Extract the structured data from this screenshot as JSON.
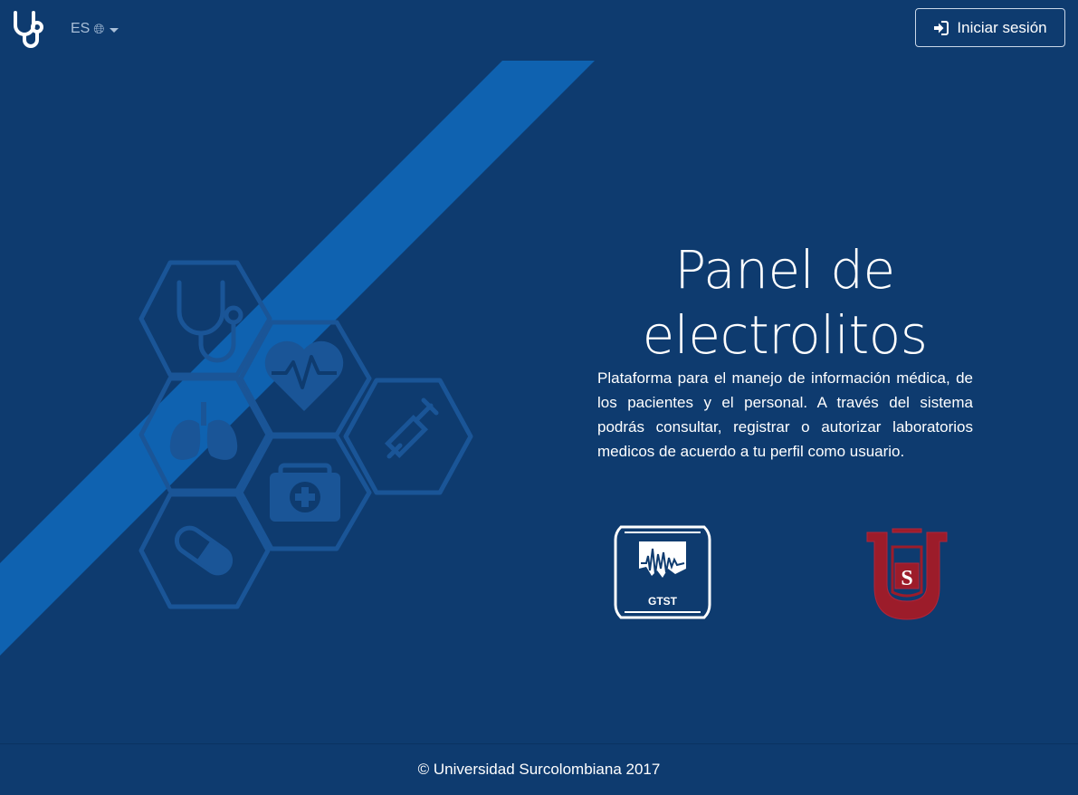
{
  "navbar": {
    "brand_icon": "stethoscope-icon",
    "language": {
      "code": "ES",
      "icon": "translate-icon"
    },
    "login_button": {
      "label": "Iniciar sesión",
      "icon": "sign-in-icon"
    }
  },
  "hero": {
    "title": "Panel de electrolitos",
    "description": "Plataforma para el manejo de información médica, de los pacientes y el personal. A través del sistema podrás consultar, registrar o autorizar laboratorios medicos de acuerdo a tu perfil como usuario.",
    "illustration_icons": [
      "stethoscope-icon",
      "heart-rate-icon",
      "lungs-icon",
      "syringe-icon",
      "medical-kit-icon",
      "pill-icon"
    ]
  },
  "logos": {
    "gtst_label": "GTST",
    "usco_letters": "US"
  },
  "footer": {
    "copyright": "© Universidad Surcolombiana 2017"
  },
  "colors": {
    "background": "#0e3b6f",
    "stripe": "#0f62b0",
    "hex_outline": "#1a5597",
    "usco_red": "#9c1c2a"
  }
}
